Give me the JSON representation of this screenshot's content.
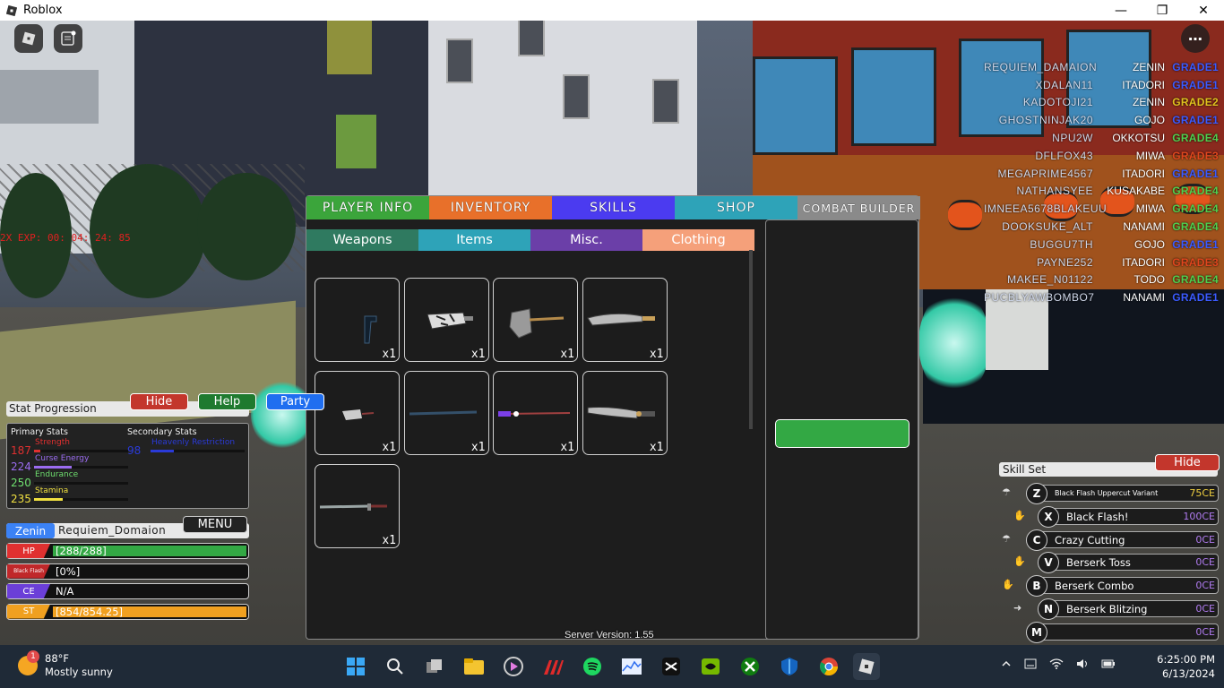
{
  "window": {
    "title": "Roblox",
    "minimize": "—",
    "restore": "❐",
    "close": "✕"
  },
  "hud": {
    "exp_buff": "2X EXP: 00: 04: 24: 85",
    "more_icon": "⋯"
  },
  "leaderboard": [
    {
      "name": "REQUIEM_DAMAION",
      "clan": "ZENIN",
      "grade": "GRADE1",
      "color": "#3b5bff"
    },
    {
      "name": "XDALAN11",
      "clan": "ITADORI",
      "grade": "GRADE1",
      "color": "#3b5bff"
    },
    {
      "name": "KADOTOJI21",
      "clan": "ZENIN",
      "grade": "GRADE2",
      "color": "#e0c21e"
    },
    {
      "name": "GHOSTNINJAK20",
      "clan": "GOJO",
      "grade": "GRADE1",
      "color": "#3b5bff"
    },
    {
      "name": "NPU2W",
      "clan": "OKKOTSU",
      "grade": "GRADE4",
      "color": "#4fd04f"
    },
    {
      "name": "DFLFOX43",
      "clan": "MIWA",
      "grade": "GRADE3",
      "color": "#e0461e"
    },
    {
      "name": "MEGAPRIME4567",
      "clan": "ITADORI",
      "grade": "GRADE1",
      "color": "#3b5bff"
    },
    {
      "name": "NATHANSYEE",
      "clan": "KUSAKABE",
      "grade": "GRADE4",
      "color": "#4fd04f"
    },
    {
      "name": "IMNEEA5678BLAKEUU",
      "clan": "MIWA",
      "grade": "GRADE4",
      "color": "#4fd04f"
    },
    {
      "name": "DOOKSUKE_ALT",
      "clan": "NANAMI",
      "grade": "GRADE4",
      "color": "#4fd04f"
    },
    {
      "name": "BUGGU7TH",
      "clan": "GOJO",
      "grade": "GRADE1",
      "color": "#3b5bff"
    },
    {
      "name": "PAYNE252",
      "clan": "ITADORI",
      "grade": "GRADE3",
      "color": "#e0461e"
    },
    {
      "name": "MAKEE_N01122",
      "clan": "TODO",
      "grade": "GRADE4",
      "color": "#4fd04f"
    },
    {
      "name": "PUCBLYAWBOMBO7",
      "clan": "NANAMI",
      "grade": "GRADE1",
      "color": "#3b5bff"
    }
  ],
  "menu": {
    "tabs": [
      {
        "label": "PLAYER INFO",
        "color": "#3ba53b"
      },
      {
        "label": "INVENTORY",
        "color": "#e8702a"
      },
      {
        "label": "SKILLS",
        "color": "#4b3bf0"
      },
      {
        "label": "SHOP",
        "color": "#2ea3b8"
      },
      {
        "label": "COMBAT BUILDER",
        "color": "#8a8a8a"
      }
    ],
    "subtabs": [
      {
        "label": "Weapons",
        "color": "#2f7a60"
      },
      {
        "label": "Items",
        "color": "#2ea3b8"
      },
      {
        "label": "Misc.",
        "color": "#6b3fa8"
      },
      {
        "label": "Clothing",
        "color": "#f5a07a"
      }
    ],
    "items": [
      {
        "icon": "pistol-icon",
        "qty": "x1"
      },
      {
        "icon": "cleaver-icon",
        "qty": "x1"
      },
      {
        "icon": "axe-icon",
        "qty": "x1"
      },
      {
        "icon": "curved-blade-icon",
        "qty": "x1"
      },
      {
        "icon": "knife-icon",
        "qty": "x1"
      },
      {
        "icon": "staff-icon",
        "qty": "x1"
      },
      {
        "icon": "spear-icon",
        "qty": "x1"
      },
      {
        "icon": "machete-icon",
        "qty": "x1"
      },
      {
        "icon": "katana-icon",
        "qty": "x1"
      }
    ],
    "server_version": "Server Version: 1.55"
  },
  "stats": {
    "header": "Stat Progression",
    "hide": "Hide",
    "help": "Help",
    "party": "Party",
    "primary_label": "Primary Stats",
    "secondary_label": "Secondary Stats",
    "primary": [
      {
        "num": "187",
        "name": "Strength",
        "color": "#e03030",
        "fill": 0.07
      },
      {
        "num": "224",
        "name": "Curse Energy",
        "color": "#9b6cf0",
        "fill": 0.4
      },
      {
        "num": "250",
        "name": "Endurance",
        "color": "#6fdf6f",
        "fill": 0.0
      },
      {
        "num": "235",
        "name": "Stamina",
        "color": "#f0e040",
        "fill": 0.3
      }
    ],
    "secondary": [
      {
        "num": "98",
        "name": "Heavenly Restriction",
        "color": "#2a3ad8",
        "fill": 0.25
      }
    ]
  },
  "player": {
    "family": "Zenin",
    "username": "Requiem_Domaion",
    "menu_label": "MENU",
    "bars": [
      {
        "tag": "HP",
        "value": "[288/288]",
        "tag_color": "#e03030",
        "fill_color": "#33a844",
        "fill": 1.0
      },
      {
        "tag": "Black Flash",
        "value": "[0%]",
        "tag_color": "#c0282a",
        "fill_color": "#c0282a",
        "fill": 0.0
      },
      {
        "tag": "CE",
        "value": "N/A",
        "tag_color": "#6b3fd8",
        "fill_color": "#6b3fd8",
        "fill": 0.0
      },
      {
        "tag": "ST",
        "value": "[854/854.25]",
        "tag_color": "#f0a020",
        "fill_color": "#f0a020",
        "fill": 1.0
      }
    ]
  },
  "skills": {
    "header": "Skill Set",
    "hide": "Hide",
    "list": [
      {
        "key": "Z",
        "name": "Black Flash Uppercut Variant",
        "cost": "75CE",
        "cost_color": "#f0d040"
      },
      {
        "key": "X",
        "name": "Black Flash!",
        "cost": "100CE",
        "cost_color": "#b07bf0"
      },
      {
        "key": "C",
        "name": "Crazy Cutting",
        "cost": "0CE",
        "cost_color": "#b07bf0"
      },
      {
        "key": "V",
        "name": "Berserk Toss",
        "cost": "0CE",
        "cost_color": "#b07bf0"
      },
      {
        "key": "B",
        "name": "Berserk Combo",
        "cost": "0CE",
        "cost_color": "#b07bf0"
      },
      {
        "key": "N",
        "name": "Berserk Blitzing",
        "cost": "0CE",
        "cost_color": "#b07bf0"
      },
      {
        "key": "M",
        "name": "",
        "cost": "0CE",
        "cost_color": "#b07bf0"
      }
    ]
  },
  "taskbar": {
    "weather_temp": "88°F",
    "weather_desc": "Mostly sunny",
    "weather_badge": "1",
    "time": "6:25:00 PM",
    "date": "6/13/2024"
  }
}
